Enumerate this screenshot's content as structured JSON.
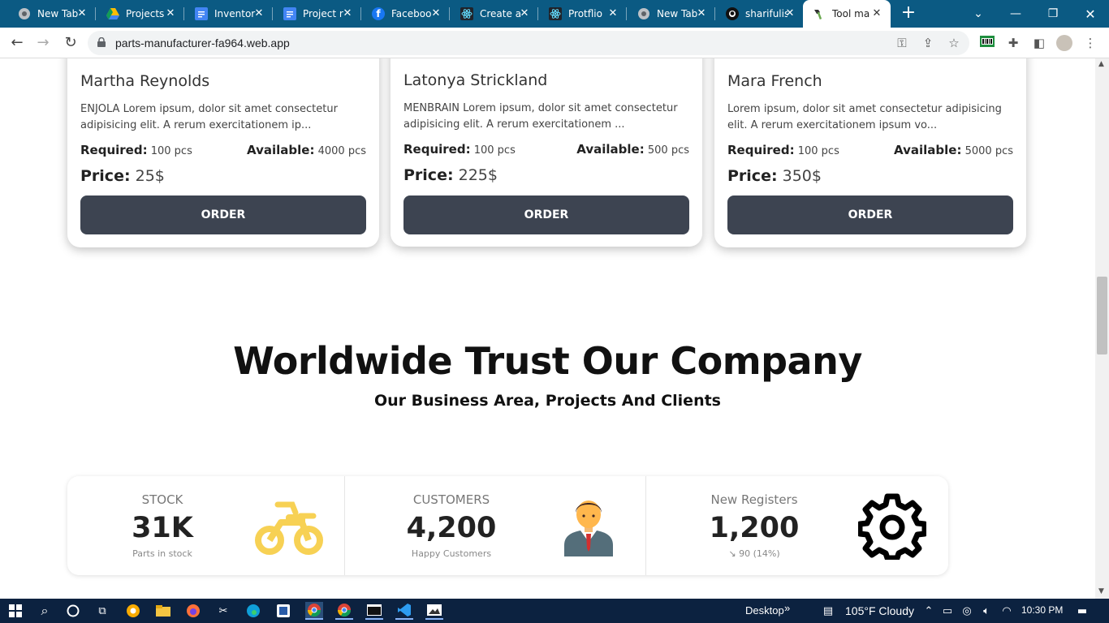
{
  "browser": {
    "tabs": [
      {
        "title": "New Tab",
        "icon": "chrome-icon",
        "active": false
      },
      {
        "title": "Projects",
        "icon": "google-drive-icon",
        "active": false
      },
      {
        "title": "Inventor",
        "icon": "google-docs-icon",
        "active": false
      },
      {
        "title": "Project r",
        "icon": "google-docs-icon",
        "active": false
      },
      {
        "title": "Faceboo",
        "icon": "facebook-icon",
        "active": false
      },
      {
        "title": "Create a",
        "icon": "react-icon",
        "active": false
      },
      {
        "title": "Protflio",
        "icon": "react-icon",
        "active": false
      },
      {
        "title": "New Tab",
        "icon": "chrome-icon",
        "active": false
      },
      {
        "title": "sharifulis",
        "icon": "github-icon",
        "active": false
      },
      {
        "title": "Tool ma",
        "icon": "tool-icon",
        "active": true
      }
    ],
    "url": "parts-manufacturer-fa964.web.app"
  },
  "products": [
    {
      "name": "Martha Reynolds",
      "description": "ENJOLA Lorem ipsum, dolor sit amet consectetur adipisicing elit. A rerum exercitationem ip...",
      "required_label": "Required:",
      "required_value": "100 pcs",
      "available_label": "Available:",
      "available_value": "4000 pcs",
      "price_label": "Price:",
      "price_value": "25$",
      "order_label": "ORDER"
    },
    {
      "name": "Latonya Strickland",
      "description": "MENBRAIN Lorem ipsum, dolor sit amet consectetur adipisicing elit. A rerum exercitationem ...",
      "required_label": "Required:",
      "required_value": "100 pcs",
      "available_label": "Available:",
      "available_value": "500 pcs",
      "price_label": "Price:",
      "price_value": "225$",
      "order_label": "ORDER"
    },
    {
      "name": "Mara French",
      "description": "Lorem ipsum, dolor sit amet consectetur adipisicing elit. A rerum exercitationem ipsum vo...",
      "required_label": "Required:",
      "required_value": "100 pcs",
      "available_label": "Available:",
      "available_value": "5000 pcs",
      "price_label": "Price:",
      "price_value": "350$",
      "order_label": "ORDER"
    }
  ],
  "trust_section": {
    "title": "Worldwide Trust Our Company",
    "subtitle": "Our Business Area, Projects And Clients"
  },
  "stats": [
    {
      "label": "STOCK",
      "value": "31K",
      "desc": "Parts in stock",
      "icon": "motorcycle-icon",
      "icon_color": "#f7d154"
    },
    {
      "label": "CUSTOMERS",
      "value": "4,200",
      "desc": "Happy Customers",
      "icon": "businessman-icon"
    },
    {
      "label": "New Registers",
      "value": "1,200",
      "desc": "↘ 90 (14%)",
      "icon": "gear-icon"
    }
  ],
  "taskbar": {
    "desktop_label": "Desktop",
    "weather": "105°F  Cloudy",
    "time": "10:30 PM"
  },
  "colors": {
    "tabstrip": "#0b5a83",
    "button": "#3d4451",
    "taskbar": "#0c2240"
  }
}
